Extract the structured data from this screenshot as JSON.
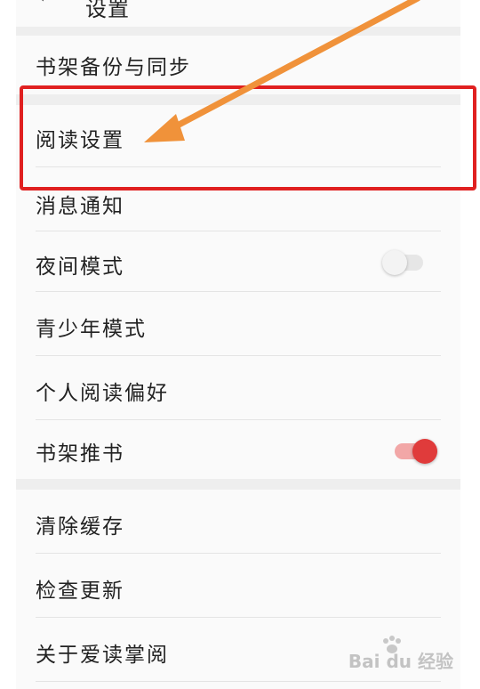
{
  "header": {
    "back_icon": "chevron-left-icon",
    "title": "设置"
  },
  "settings": {
    "backup_sync": "书架备份与同步",
    "reading_settings": "阅读设置",
    "notifications": "消息通知",
    "night_mode": "夜间模式",
    "night_mode_on": false,
    "teen_mode": "青少年模式",
    "reading_preference": "个人阅读偏好",
    "shelf_recommend": "书架推书",
    "shelf_recommend_on": true,
    "clear_cache": "清除缓存",
    "check_update": "检查更新",
    "about": "关于爱读掌阅"
  },
  "annotations": {
    "highlight_color": "#e02020",
    "arrow_color": "#f0923a"
  },
  "watermark": {
    "text": "Bai du 经验"
  },
  "colors": {
    "toggle_on": "#e03b3b",
    "toggle_off": "#e6e6e6"
  }
}
